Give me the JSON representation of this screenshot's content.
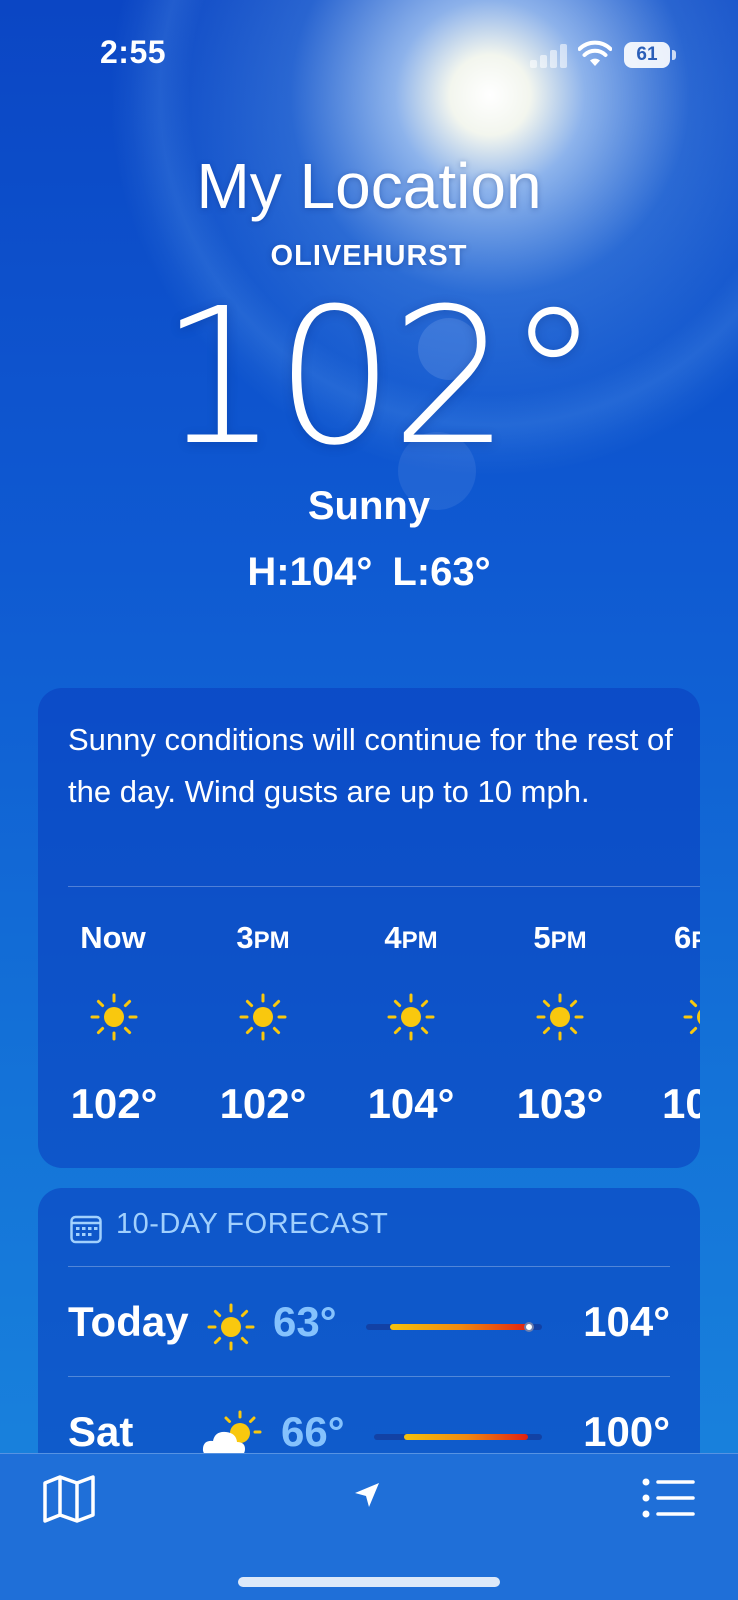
{
  "status_bar": {
    "time": "2:55",
    "battery": "61"
  },
  "header": {
    "title": "My Location",
    "subtitle": "OLIVEHURST",
    "temperature": "102°",
    "condition": "Sunny",
    "high": "H:104°",
    "low": "L:63°"
  },
  "hourly_card": {
    "summary": "Sunny conditions will continue for the rest of the day. Wind gusts are up to 10 mph.",
    "hours": [
      {
        "time": "Now",
        "icon": "sun-icon",
        "temp": "102°"
      },
      {
        "time": "3",
        "suffix": "PM",
        "icon": "sun-icon",
        "temp": "102°"
      },
      {
        "time": "4",
        "suffix": "PM",
        "icon": "sun-icon",
        "temp": "104°"
      },
      {
        "time": "5",
        "suffix": "PM",
        "icon": "sun-icon",
        "temp": "103°"
      },
      {
        "time": "6",
        "suffix": "PM",
        "icon": "sun-icon",
        "temp": "10"
      }
    ]
  },
  "forecast_card": {
    "heading": "10-DAY FORECAST",
    "days": [
      {
        "day": "Today",
        "icon": "sun-icon",
        "low": "63°",
        "high": "104°"
      },
      {
        "day": "Sat",
        "icon": "partly-cloudy-icon",
        "low": "66°",
        "high": "100°"
      }
    ]
  },
  "toolbar": {
    "icons": [
      "map-icon",
      "location-arrow-icon",
      "list-icon"
    ]
  },
  "colors": {
    "background_top": "#0b46c4",
    "background_bottom": "#1a86de",
    "sun_yellow": "#f9c80e",
    "low_temp_blue": "#8cc8ff",
    "range_start": "#f4c20d",
    "range_end": "#e02010"
  }
}
